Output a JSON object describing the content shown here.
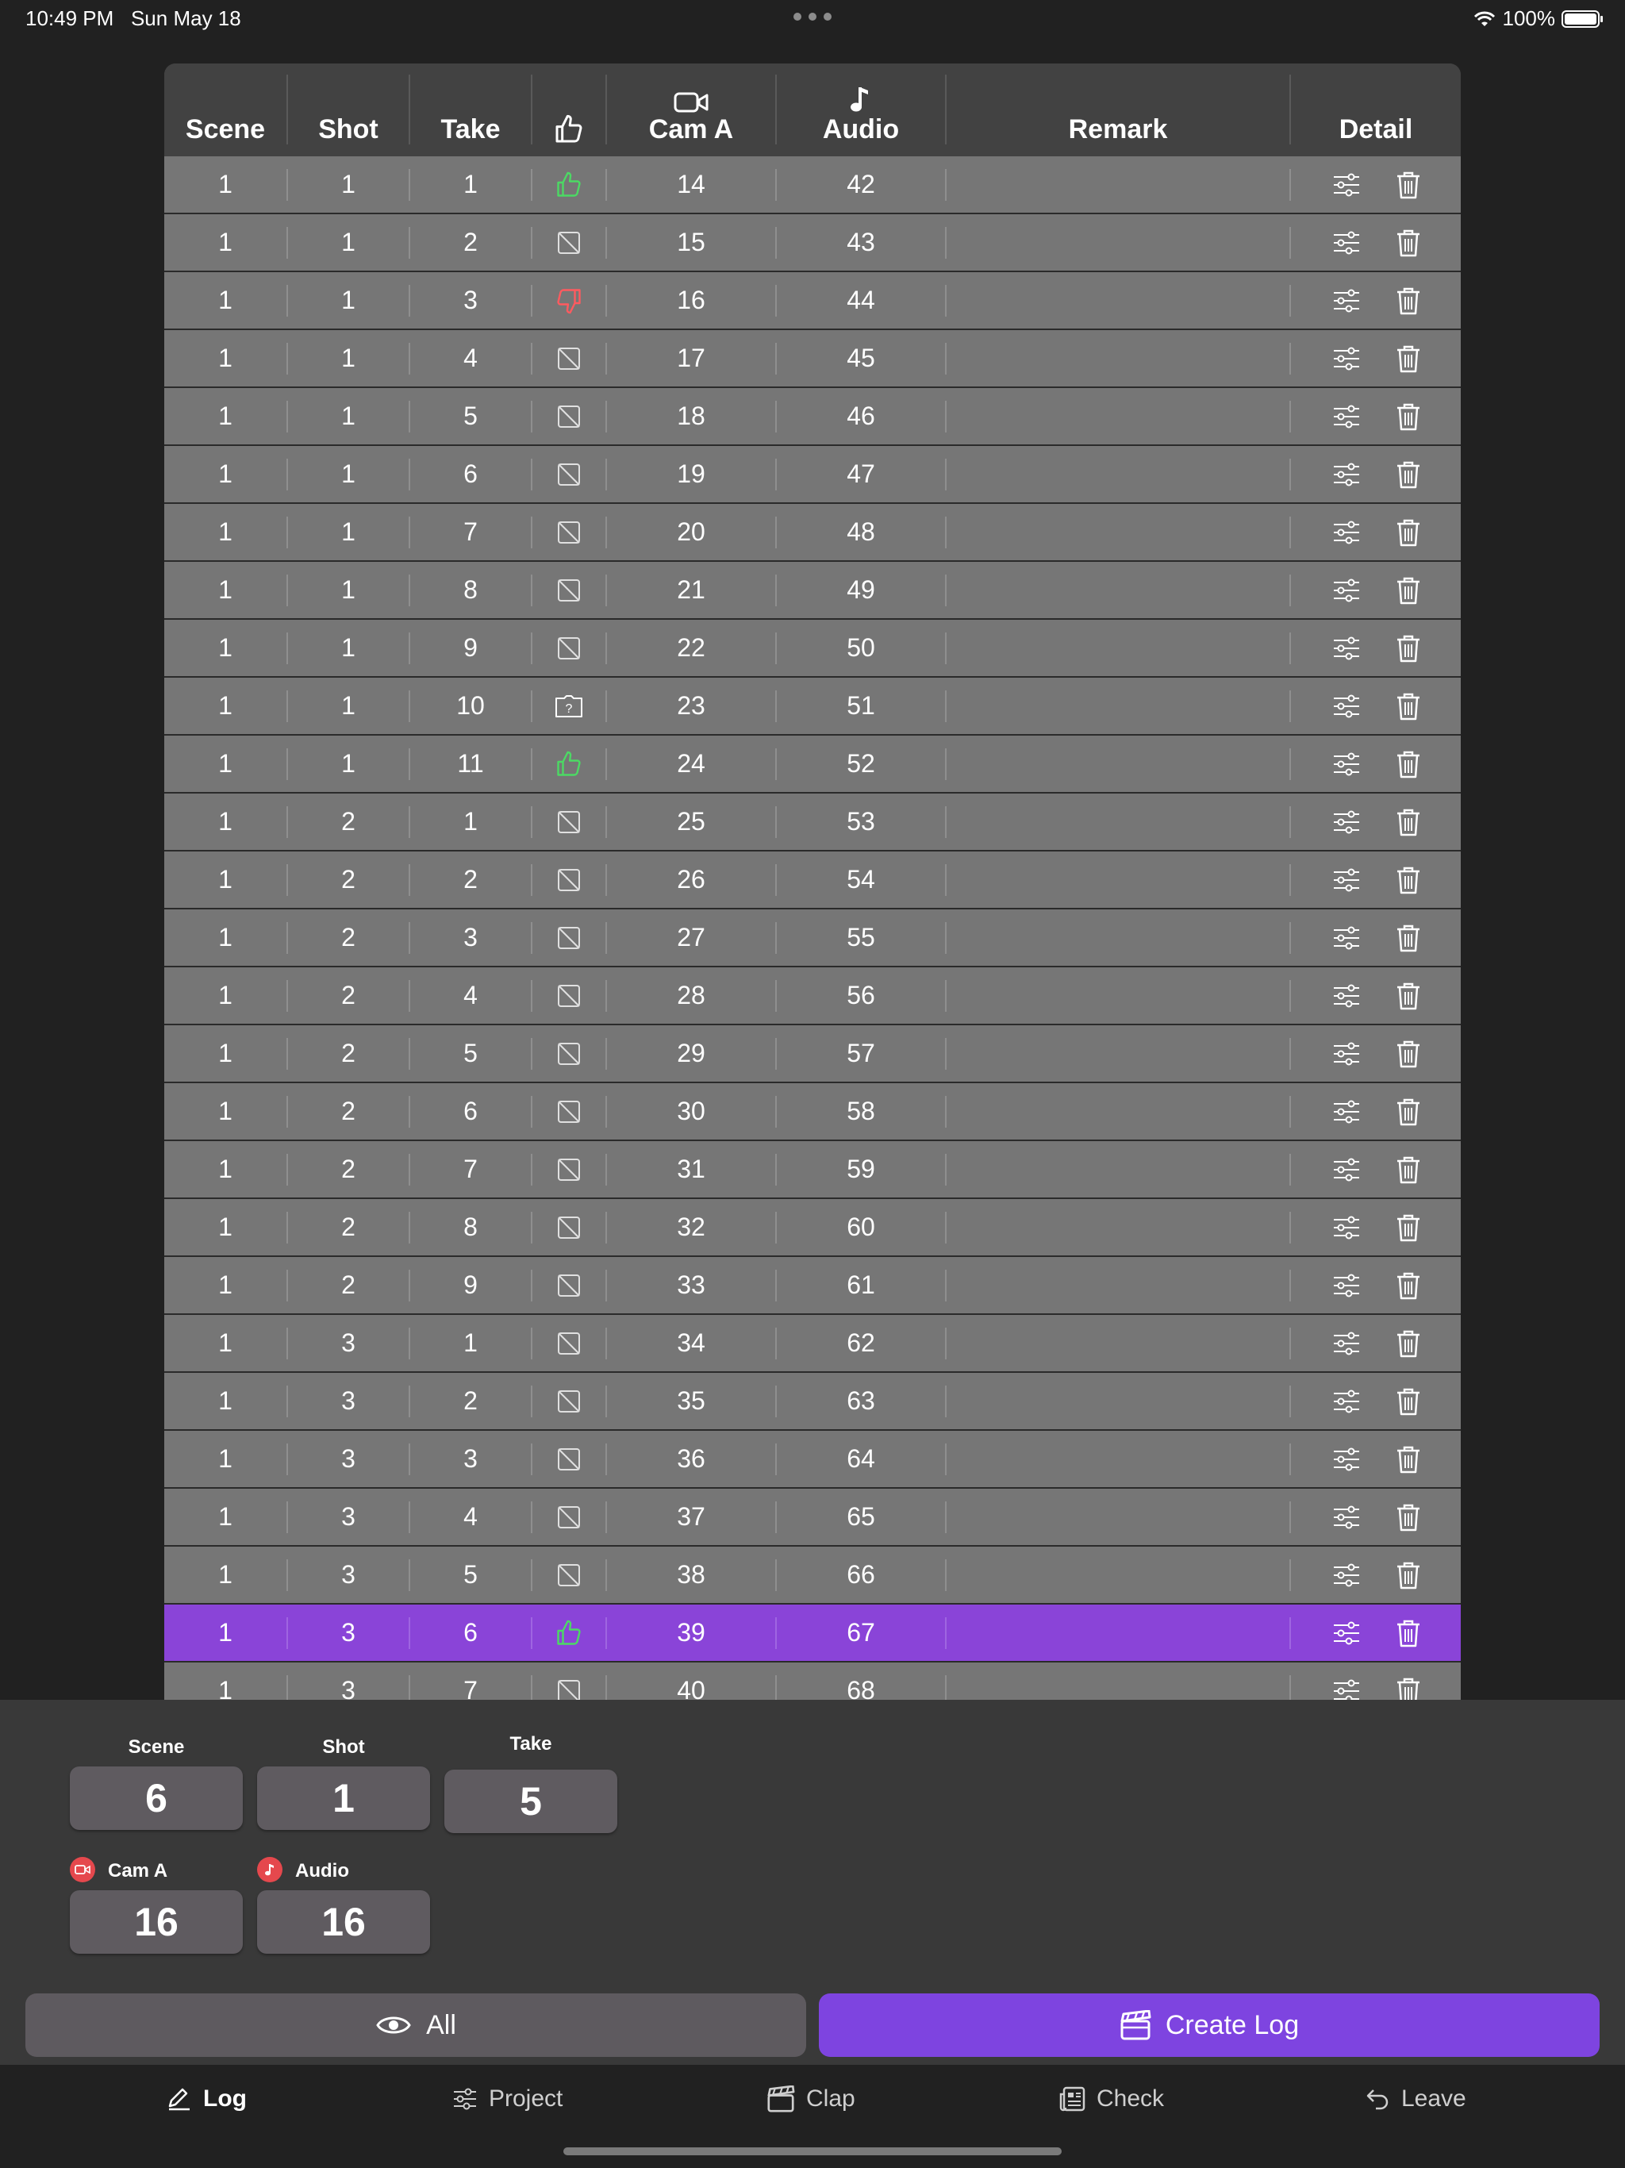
{
  "status": {
    "time": "10:49 PM",
    "date": "Sun May 18",
    "battery": "100%",
    "battery_level": 1.0
  },
  "table": {
    "headers": {
      "scene": "Scene",
      "shot": "Shot",
      "take": "Take",
      "rating_icon": "thumbs-up-icon",
      "cam": "Cam A",
      "cam_icon": "video-camera-icon",
      "audio": "Audio",
      "audio_icon": "music-note-icon",
      "remark": "Remark",
      "detail": "Detail"
    },
    "rows": [
      {
        "scene": "1",
        "shot": "1",
        "take": "1",
        "rating": "good",
        "cam": "14",
        "audio": "42",
        "remark": ""
      },
      {
        "scene": "1",
        "shot": "1",
        "take": "2",
        "rating": "none",
        "cam": "15",
        "audio": "43",
        "remark": ""
      },
      {
        "scene": "1",
        "shot": "1",
        "take": "3",
        "rating": "bad",
        "cam": "16",
        "audio": "44",
        "remark": ""
      },
      {
        "scene": "1",
        "shot": "1",
        "take": "4",
        "rating": "none",
        "cam": "17",
        "audio": "45",
        "remark": ""
      },
      {
        "scene": "1",
        "shot": "1",
        "take": "5",
        "rating": "none",
        "cam": "18",
        "audio": "46",
        "remark": ""
      },
      {
        "scene": "1",
        "shot": "1",
        "take": "6",
        "rating": "none",
        "cam": "19",
        "audio": "47",
        "remark": ""
      },
      {
        "scene": "1",
        "shot": "1",
        "take": "7",
        "rating": "none",
        "cam": "20",
        "audio": "48",
        "remark": ""
      },
      {
        "scene": "1",
        "shot": "1",
        "take": "8",
        "rating": "none",
        "cam": "21",
        "audio": "49",
        "remark": ""
      },
      {
        "scene": "1",
        "shot": "1",
        "take": "9",
        "rating": "none",
        "cam": "22",
        "audio": "50",
        "remark": ""
      },
      {
        "scene": "1",
        "shot": "1",
        "take": "10",
        "rating": "question",
        "cam": "23",
        "audio": "51",
        "remark": ""
      },
      {
        "scene": "1",
        "shot": "1",
        "take": "11",
        "rating": "good",
        "cam": "24",
        "audio": "52",
        "remark": ""
      },
      {
        "scene": "1",
        "shot": "2",
        "take": "1",
        "rating": "none",
        "cam": "25",
        "audio": "53",
        "remark": ""
      },
      {
        "scene": "1",
        "shot": "2",
        "take": "2",
        "rating": "none",
        "cam": "26",
        "audio": "54",
        "remark": ""
      },
      {
        "scene": "1",
        "shot": "2",
        "take": "3",
        "rating": "none",
        "cam": "27",
        "audio": "55",
        "remark": ""
      },
      {
        "scene": "1",
        "shot": "2",
        "take": "4",
        "rating": "none",
        "cam": "28",
        "audio": "56",
        "remark": ""
      },
      {
        "scene": "1",
        "shot": "2",
        "take": "5",
        "rating": "none",
        "cam": "29",
        "audio": "57",
        "remark": ""
      },
      {
        "scene": "1",
        "shot": "2",
        "take": "6",
        "rating": "none",
        "cam": "30",
        "audio": "58",
        "remark": ""
      },
      {
        "scene": "1",
        "shot": "2",
        "take": "7",
        "rating": "none",
        "cam": "31",
        "audio": "59",
        "remark": ""
      },
      {
        "scene": "1",
        "shot": "2",
        "take": "8",
        "rating": "none",
        "cam": "32",
        "audio": "60",
        "remark": ""
      },
      {
        "scene": "1",
        "shot": "2",
        "take": "9",
        "rating": "none",
        "cam": "33",
        "audio": "61",
        "remark": ""
      },
      {
        "scene": "1",
        "shot": "3",
        "take": "1",
        "rating": "none",
        "cam": "34",
        "audio": "62",
        "remark": ""
      },
      {
        "scene": "1",
        "shot": "3",
        "take": "2",
        "rating": "none",
        "cam": "35",
        "audio": "63",
        "remark": ""
      },
      {
        "scene": "1",
        "shot": "3",
        "take": "3",
        "rating": "none",
        "cam": "36",
        "audio": "64",
        "remark": ""
      },
      {
        "scene": "1",
        "shot": "3",
        "take": "4",
        "rating": "none",
        "cam": "37",
        "audio": "65",
        "remark": ""
      },
      {
        "scene": "1",
        "shot": "3",
        "take": "5",
        "rating": "none",
        "cam": "38",
        "audio": "66",
        "remark": ""
      },
      {
        "scene": "1",
        "shot": "3",
        "take": "6",
        "rating": "good",
        "cam": "39",
        "audio": "67",
        "remark": "",
        "selected": true
      },
      {
        "scene": "1",
        "shot": "3",
        "take": "7",
        "rating": "none",
        "cam": "40",
        "audio": "68",
        "remark": ""
      }
    ]
  },
  "entry": {
    "scene_label": "Scene",
    "scene_value": "6",
    "shot_label": "Shot",
    "shot_value": "1",
    "take_label": "Take",
    "take_value": "5",
    "cam_label": "Cam A",
    "cam_value": "16",
    "audio_label": "Audio",
    "audio_value": "16"
  },
  "actions": {
    "all_label": "All",
    "create_label": "Create Log"
  },
  "tabs": [
    {
      "label": "Log",
      "icon": "pencil-icon",
      "active": true
    },
    {
      "label": "Project",
      "icon": "sliders-icon",
      "active": false
    },
    {
      "label": "Clap",
      "icon": "clapperboard-icon",
      "active": false
    },
    {
      "label": "Check",
      "icon": "newspaper-icon",
      "active": false
    },
    {
      "label": "Leave",
      "icon": "arrow-uturn-left-icon",
      "active": false
    }
  ],
  "colors": {
    "accent": "#7e44e0",
    "selected_row": "#8a44d8",
    "row": "#767676",
    "good": "#4cd964",
    "bad": "#ff5a5f",
    "record_dot": "#e5484d"
  }
}
